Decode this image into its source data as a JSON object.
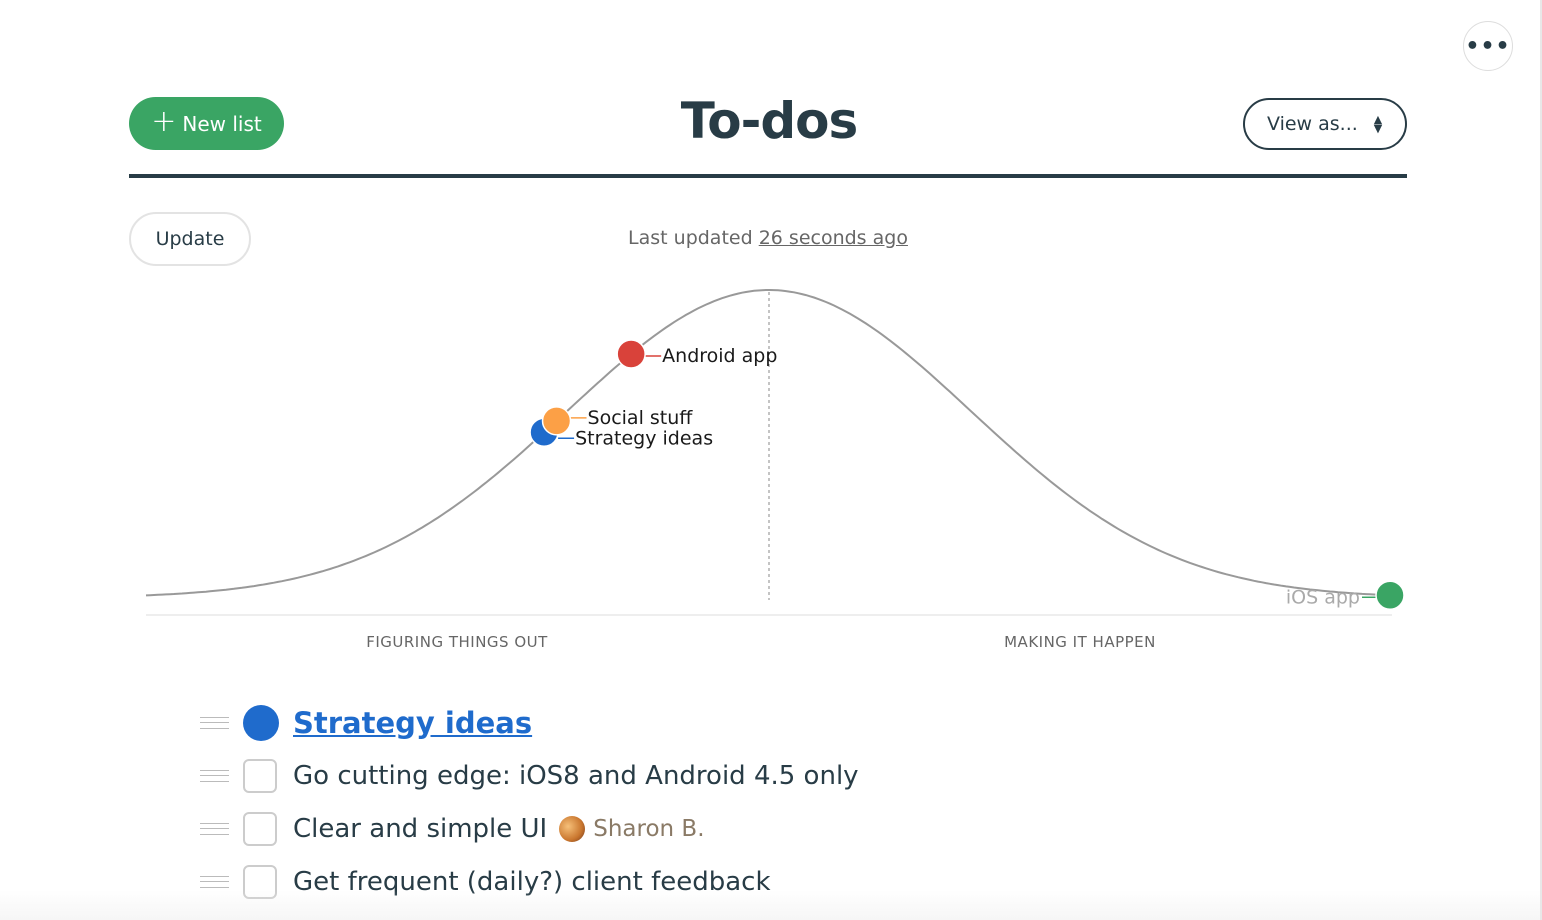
{
  "header": {
    "more_label": "•••",
    "new_list_label": "New list",
    "title": "To-dos",
    "view_as_label": "View as..."
  },
  "hill": {
    "update_label": "Update",
    "last_updated_prefix": "Last updated",
    "last_updated_link": "26 seconds ago",
    "left_label": "FIGURING THINGS OUT",
    "right_label": "MAKING IT HAPPEN"
  },
  "chart_data": {
    "type": "hill",
    "points": [
      {
        "label": "Strategy ideas",
        "position_pct": 32,
        "color": "#1f6bcc"
      },
      {
        "label": "Social stuff",
        "position_pct": 33,
        "color": "#fca046"
      },
      {
        "label": "Android app",
        "position_pct": 39,
        "color": "#d9423a"
      },
      {
        "label": "iOS app",
        "position_pct": 100,
        "color": "#3aa564"
      }
    ]
  },
  "list": {
    "name": "Strategy ideas",
    "color": "#1f6bcc",
    "items": [
      {
        "text": "Go cutting edge: iOS8 and Android 4.5 only"
      },
      {
        "text": "Clear and simple UI",
        "assignee": "Sharon B."
      },
      {
        "text": "Get frequent (daily?) client feedback"
      }
    ]
  }
}
